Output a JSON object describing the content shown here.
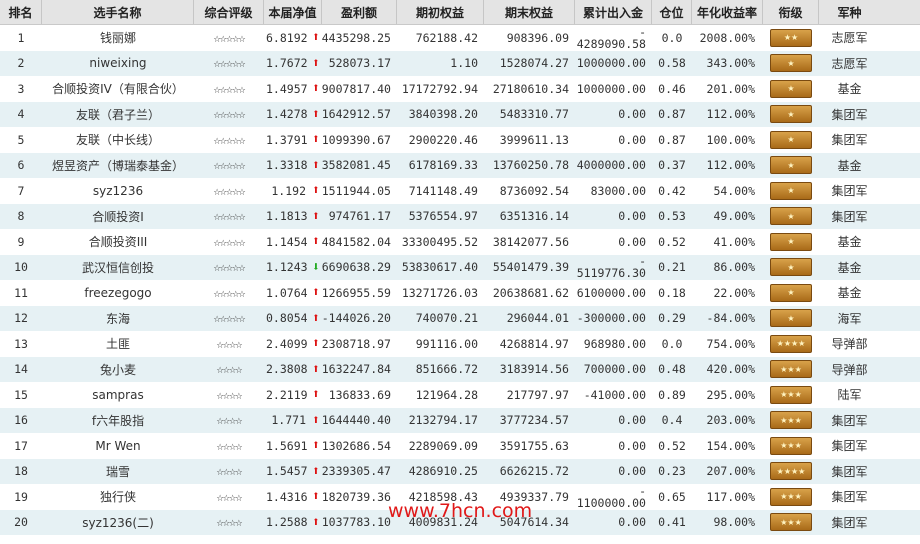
{
  "headers": [
    "排名",
    "选手名称",
    "综合评级",
    "本届净值",
    "盈利额",
    "期初权益",
    "期末权益",
    "累计出入金",
    "仓位",
    "年化收益率",
    "衔级",
    "军种"
  ],
  "colors": {
    "up_arrow": "#dd1111",
    "down_arrow": "#22aa22",
    "stripe": "#e6f1f4",
    "header_bg": "#e4e4e4",
    "badge": "#c48a30",
    "watermark": "#e01818"
  },
  "rows": [
    {
      "rank": "1",
      "name": "钱丽娜",
      "rating": "☆☆☆☆☆",
      "nav": "6.8192",
      "trend": "up",
      "profit": "4435298.25",
      "start": "762188.42",
      "end": "908396.09",
      "flow": [
        "-",
        "4289090.58"
      ],
      "position": "0.0",
      "annual": "2008.00%",
      "badge": "★★",
      "arm": "志愿军"
    },
    {
      "rank": "2",
      "name": "niweixing",
      "rating": "☆☆☆☆☆",
      "nav": "1.7672",
      "trend": "up",
      "profit": "528073.17",
      "start": "1.10",
      "end": "1528074.27",
      "flow": [
        "1000000.00"
      ],
      "position": "0.58",
      "annual": "343.00%",
      "badge": "★",
      "arm": "志愿军"
    },
    {
      "rank": "3",
      "name": "合顺投资IV（有限合伙）",
      "rating": "☆☆☆☆☆",
      "nav": "1.4957",
      "trend": "up",
      "profit": "9007817.40",
      "start": "17172792.94",
      "end": "27180610.34",
      "flow": [
        "1000000.00"
      ],
      "position": "0.46",
      "annual": "201.00%",
      "badge": "★",
      "arm": "基金"
    },
    {
      "rank": "4",
      "name": "友联（君子兰）",
      "rating": "☆☆☆☆☆",
      "nav": "1.4278",
      "trend": "up",
      "profit": "1642912.57",
      "start": "3840398.20",
      "end": "5483310.77",
      "flow": [
        "0.00"
      ],
      "position": "0.87",
      "annual": "112.00%",
      "badge": "★",
      "arm": "集团军"
    },
    {
      "rank": "5",
      "name": "友联（中长线）",
      "rating": "☆☆☆☆☆",
      "nav": "1.3791",
      "trend": "up",
      "profit": "1099390.67",
      "start": "2900220.46",
      "end": "3999611.13",
      "flow": [
        "0.00"
      ],
      "position": "0.87",
      "annual": "100.00%",
      "badge": "★",
      "arm": "集团军"
    },
    {
      "rank": "6",
      "name": "煜昱资产（博瑞泰基金）",
      "rating": "☆☆☆☆☆",
      "nav": "1.3318",
      "trend": "up",
      "profit": "3582081.45",
      "start": "6178169.33",
      "end": "13760250.78",
      "flow": [
        "4000000.00"
      ],
      "position": "0.37",
      "annual": "112.00%",
      "badge": "★",
      "arm": "基金"
    },
    {
      "rank": "7",
      "name": "syz1236",
      "rating": "☆☆☆☆☆",
      "nav": "1.192",
      "trend": "up",
      "profit": "1511944.05",
      "start": "7141148.49",
      "end": "8736092.54",
      "flow": [
        "83000.00"
      ],
      "position": "0.42",
      "annual": "54.00%",
      "badge": "★",
      "arm": "集团军"
    },
    {
      "rank": "8",
      "name": "合顺投资I",
      "rating": "☆☆☆☆☆",
      "nav": "1.1813",
      "trend": "up",
      "profit": "974761.17",
      "start": "5376554.97",
      "end": "6351316.14",
      "flow": [
        "0.00"
      ],
      "position": "0.53",
      "annual": "49.00%",
      "badge": "★",
      "arm": "集团军"
    },
    {
      "rank": "9",
      "name": "合顺投资III",
      "rating": "☆☆☆☆☆",
      "nav": "1.1454",
      "trend": "up",
      "profit": "4841582.04",
      "start": "33300495.52",
      "end": "38142077.56",
      "flow": [
        "0.00"
      ],
      "position": "0.52",
      "annual": "41.00%",
      "badge": "★",
      "arm": "基金"
    },
    {
      "rank": "10",
      "name": "武汉恒信创投",
      "rating": "☆☆☆☆☆",
      "nav": "1.1243",
      "trend": "down",
      "profit": "6690638.29",
      "start": "53830617.40",
      "end": "55401479.39",
      "flow": [
        "-",
        "5119776.30"
      ],
      "position": "0.21",
      "annual": "86.00%",
      "badge": "★",
      "arm": "基金"
    },
    {
      "rank": "11",
      "name": "freezegogo",
      "rating": "☆☆☆☆☆",
      "nav": "1.0764",
      "trend": "up",
      "profit": "1266955.59",
      "start": "13271726.03",
      "end": "20638681.62",
      "flow": [
        "6100000.00"
      ],
      "position": "0.18",
      "annual": "22.00%",
      "badge": "★",
      "arm": "基金"
    },
    {
      "rank": "12",
      "name": "东海",
      "rating": "☆☆☆☆☆",
      "nav": "0.8054",
      "trend": "up",
      "profit": "-144026.20",
      "start": "740070.21",
      "end": "296044.01",
      "flow": [
        "-300000.00"
      ],
      "position": "0.29",
      "annual": "-84.00%",
      "badge": "★",
      "arm": "海军"
    },
    {
      "rank": "13",
      "name": "土匪",
      "rating": "☆☆☆☆",
      "nav": "2.4099",
      "trend": "up",
      "profit": "2308718.97",
      "start": "991116.00",
      "end": "4268814.97",
      "flow": [
        "968980.00"
      ],
      "position": "0.0",
      "annual": "754.00%",
      "badge": "★★★★",
      "arm": "导弹部"
    },
    {
      "rank": "14",
      "name": "兔小麦",
      "rating": "☆☆☆☆",
      "nav": "2.3808",
      "trend": "up",
      "profit": "1632247.84",
      "start": "851666.72",
      "end": "3183914.56",
      "flow": [
        "700000.00"
      ],
      "position": "0.48",
      "annual": "420.00%",
      "badge": "★★★",
      "arm": "导弹部"
    },
    {
      "rank": "15",
      "name": "sampras",
      "rating": "☆☆☆☆",
      "nav": "2.2119",
      "trend": "up",
      "profit": "136833.69",
      "start": "121964.28",
      "end": "217797.97",
      "flow": [
        "-41000.00"
      ],
      "position": "0.89",
      "annual": "295.00%",
      "badge": "★★★",
      "arm": "陆军"
    },
    {
      "rank": "16",
      "name": "f六年股指",
      "rating": "☆☆☆☆",
      "nav": "1.771",
      "trend": "up",
      "profit": "1644440.40",
      "start": "2132794.17",
      "end": "3777234.57",
      "flow": [
        "0.00"
      ],
      "position": "0.4",
      "annual": "203.00%",
      "badge": "★★★",
      "arm": "集团军"
    },
    {
      "rank": "17",
      "name": "Mr Wen",
      "rating": "☆☆☆☆",
      "nav": "1.5691",
      "trend": "up",
      "profit": "1302686.54",
      "start": "2289069.09",
      "end": "3591755.63",
      "flow": [
        "0.00"
      ],
      "position": "0.52",
      "annual": "154.00%",
      "badge": "★★★",
      "arm": "集团军"
    },
    {
      "rank": "18",
      "name": "瑞雪",
      "rating": "☆☆☆☆",
      "nav": "1.5457",
      "trend": "up",
      "profit": "2339305.47",
      "start": "4286910.25",
      "end": "6626215.72",
      "flow": [
        "0.00"
      ],
      "position": "0.23",
      "annual": "207.00%",
      "badge": "★★★★",
      "arm": "集团军"
    },
    {
      "rank": "19",
      "name": "独行侠",
      "rating": "☆☆☆☆",
      "nav": "1.4316",
      "trend": "up",
      "profit": "1820739.36",
      "start": "4218598.43",
      "end": "4939337.79",
      "flow": [
        "-",
        "1100000.00"
      ],
      "position": "0.65",
      "annual": "117.00%",
      "badge": "★★★",
      "arm": "集团军"
    },
    {
      "rank": "20",
      "name": "syz1236(二)",
      "rating": "☆☆☆☆",
      "nav": "1.2588",
      "trend": "up",
      "profit": "1037783.10",
      "start": "4009831.24",
      "end": "5047614.34",
      "flow": [
        "0.00"
      ],
      "position": "0.41",
      "annual": "98.00%",
      "badge": "★★★",
      "arm": "集团军"
    }
  ],
  "watermark": "www.7hcn.com"
}
